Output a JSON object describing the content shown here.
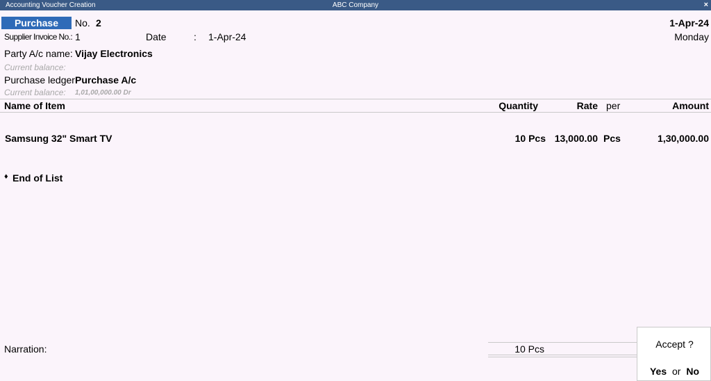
{
  "window": {
    "title": "Accounting Voucher Creation",
    "company": "ABC Company",
    "close_glyph": "×"
  },
  "voucher": {
    "type": "Purchase",
    "no_label": "No.",
    "no_value": "2",
    "date_right": "1-Apr-24",
    "day": "Monday",
    "supplier_invoice_label": "Supplier Invoice No.:",
    "supplier_invoice_value": "1",
    "date_label": "Date",
    "date_colon": ":",
    "date_value": "1-Apr-24",
    "party_label": "Party A/c name:",
    "party_value": "Vijay Electronics",
    "party_balance_label": "Current balance:",
    "purchase_ledger_label": "Purchase ledger:",
    "purchase_ledger_value": "Purchase A/c",
    "ledger_balance_label": "Current balance:",
    "ledger_balance_value": "1,01,00,000.00 Dr"
  },
  "table": {
    "headers": {
      "item": "Name of Item",
      "quantity": "Quantity",
      "rate": "Rate",
      "per": "per",
      "amount": "Amount"
    },
    "rows": [
      {
        "item": "Samsung 32\" Smart TV",
        "quantity": "10 Pcs",
        "rate": "13,000.00",
        "per": "Pcs",
        "amount": "1,30,000.00"
      }
    ],
    "end_of_list_bullet": "♦",
    "end_of_list": "End of List"
  },
  "footer": {
    "narration_label": "Narration:",
    "total_quantity": "10 Pcs"
  },
  "accept_dialog": {
    "question": "Accept ?",
    "yes": "Yes",
    "or": "or",
    "no": "No"
  }
}
